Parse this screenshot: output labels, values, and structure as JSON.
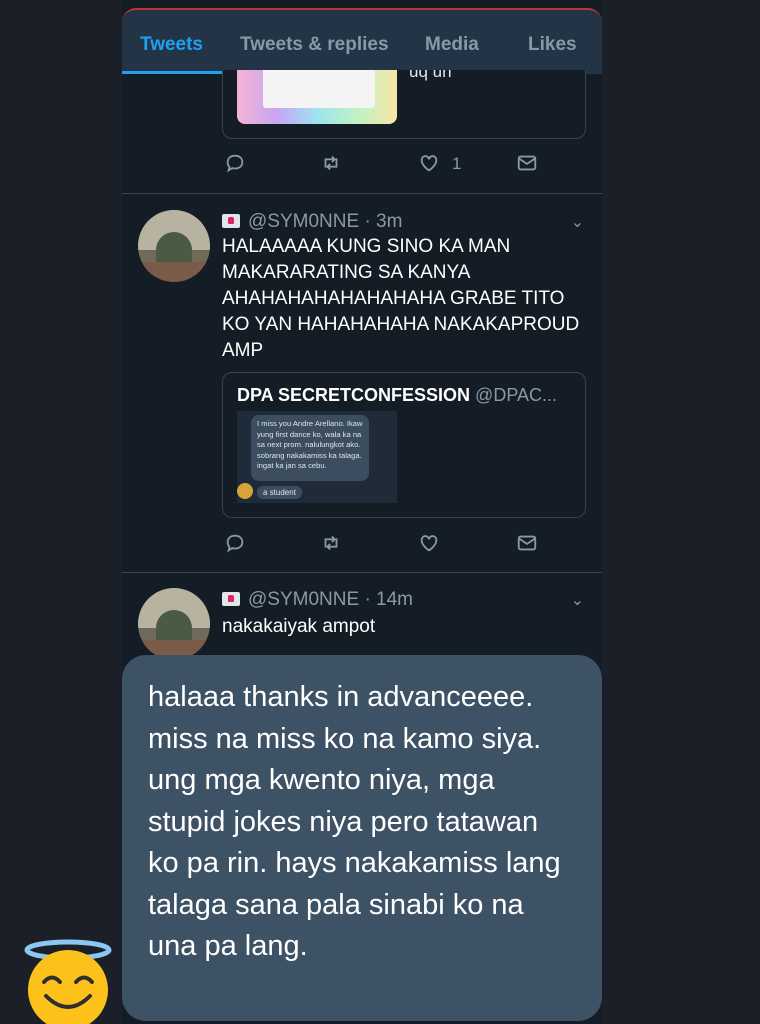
{
  "profile_tabs": {
    "items": [
      "Tweets",
      "Tweets & replies",
      "Media",
      "Likes"
    ],
    "active": "Tweets",
    "accent_color": "#1da1f2"
  },
  "tweet_1": {
    "card_partial_text": "uq un",
    "actions": {
      "reply_count": "",
      "retweet_count": "",
      "like_count": "1"
    }
  },
  "tweet_2": {
    "handle": "@SYM0NNE",
    "time": "· 3m",
    "text": "HALAAAAA KUNG SINO KA MAN MAKARARATING SA KANYA AHAHAHAHAHAHAHAHA GRABE TITO KO YAN HAHAHAHAHA NAKAKAPROUD AMP",
    "quote": {
      "author": "DPA SECRETCONFESSION",
      "handle": "@DPAC...",
      "message": "I miss you Andre Arellano. Ikaw yung first dance ko, wala ka na sa next prom. nalulungkot ako. sobrang nakakamiss ka talaga. ingat ka jan sa cebu.",
      "sender": "a student"
    },
    "actions": {
      "reply_count": "",
      "retweet_count": "",
      "like_count": ""
    }
  },
  "tweet_3": {
    "handle": "@SYM0NNE",
    "time": "· 14m",
    "text": "nakakaiyak ampot"
  },
  "message_bubble": {
    "text": "halaaa thanks in advanceeee. miss na miss ko na kamo siya. ung mga kwento niya, mga stupid jokes niya pero tatawan ko pa rin. hays nakakamiss lang talaga sana pala sinabi ko na una pa lang.",
    "emoji": "smiling-face-with-halo"
  }
}
